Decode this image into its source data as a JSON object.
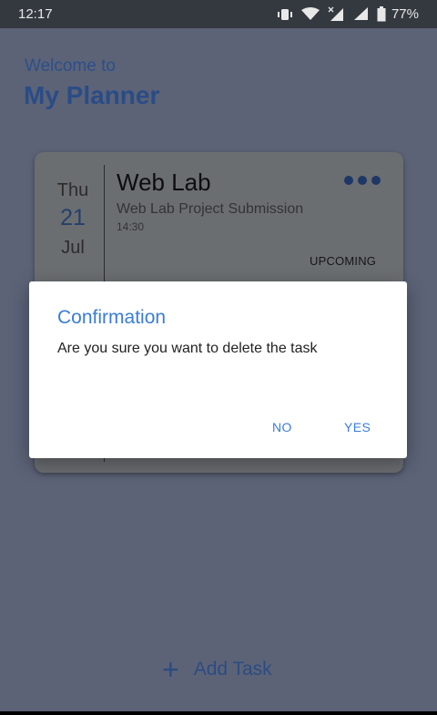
{
  "status_bar": {
    "time": "12:17",
    "battery": "77%",
    "icons": [
      "vibrate-icon",
      "wifi-icon",
      "signal-no-data-icon",
      "signal-icon",
      "battery-icon"
    ]
  },
  "header": {
    "welcome": "Welcome to",
    "title": "My Planner"
  },
  "task_card": {
    "day": "Thu",
    "date": "21",
    "month": "Jul",
    "title": "Web Lab",
    "description": "Web Lab Project Submission",
    "time": "14:30",
    "status": "UPCOMING",
    "menu_icon": "more-horizontal-icon"
  },
  "add_task": {
    "label": "Add Task",
    "icon": "plus-icon"
  },
  "dialog": {
    "title": "Confirmation",
    "message": "Are you sure you want to delete the task",
    "no_label": "NO",
    "yes_label": "YES"
  },
  "colors": {
    "accent": "#3b7dd8",
    "brand_dark": "#2a4c86",
    "scrim": "#5c6377",
    "status_bar": "#34383f"
  }
}
